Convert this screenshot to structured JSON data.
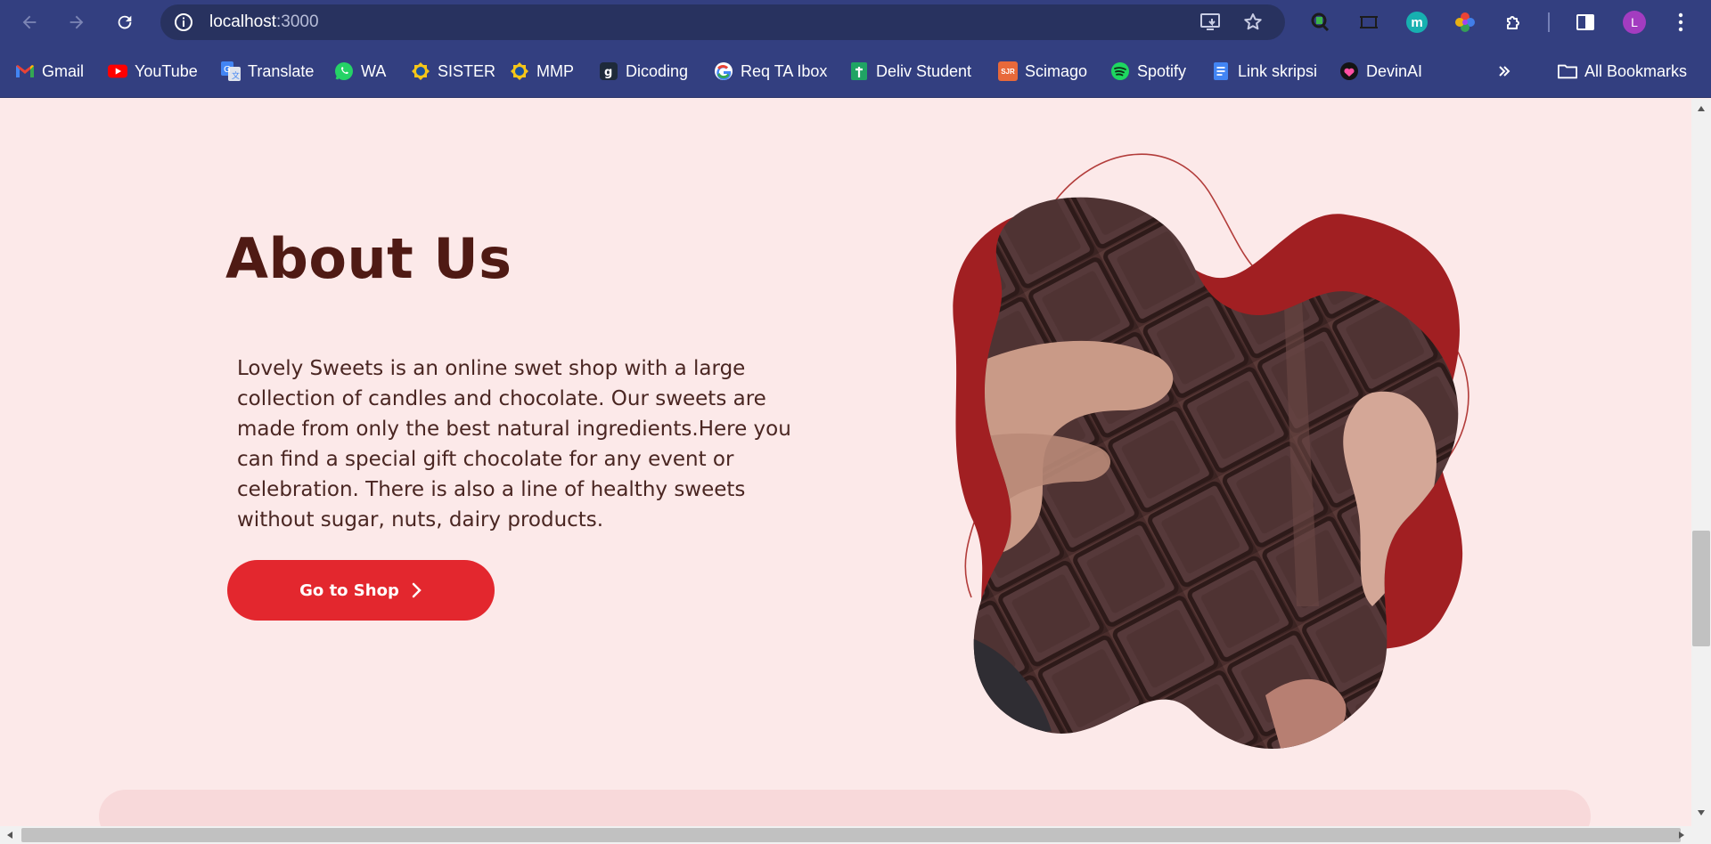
{
  "browser": {
    "url_host": "localhost",
    "url_port": ":3000",
    "profile_initial": "L",
    "extension_initial": "m"
  },
  "bookmarks": [
    {
      "label": "Gmail",
      "icon": "gmail-icon"
    },
    {
      "label": "YouTube",
      "icon": "youtube-icon"
    },
    {
      "label": "Translate",
      "icon": "translate-icon"
    },
    {
      "label": "WA",
      "icon": "whatsapp-icon"
    },
    {
      "label": "SISTER",
      "icon": "sister-icon"
    },
    {
      "label": "MMP",
      "icon": "mmp-icon"
    },
    {
      "label": "Dicoding",
      "icon": "dicoding-icon"
    },
    {
      "label": "Req TA Ibox",
      "icon": "google-icon"
    },
    {
      "label": "Deliv Student",
      "icon": "sheets-icon"
    },
    {
      "label": "Scimago",
      "icon": "scimago-icon"
    },
    {
      "label": "Spotify",
      "icon": "spotify-icon"
    },
    {
      "label": "Link skripsi",
      "icon": "docs-icon"
    },
    {
      "label": "DevinAI",
      "icon": "devinai-icon"
    }
  ],
  "all_bookmarks": "All Bookmarks",
  "scimago_badge": "SJR",
  "about": {
    "title": "About Us",
    "body": "Lovely Sweets is an online swet shop with a large collection of candles and chocolate. Our sweets are made from only the best natural ingredients.Here you can find a special gift chocolate for any event or celebration. There is also a line of healthy sweets without sugar, nuts, dairy products.",
    "button": "Go to Shop"
  },
  "colors": {
    "chrome": "#333f80",
    "page_bg": "#fce9e9",
    "title": "#4f1a14",
    "button": "#e3272e",
    "blob": "#a11f22"
  }
}
